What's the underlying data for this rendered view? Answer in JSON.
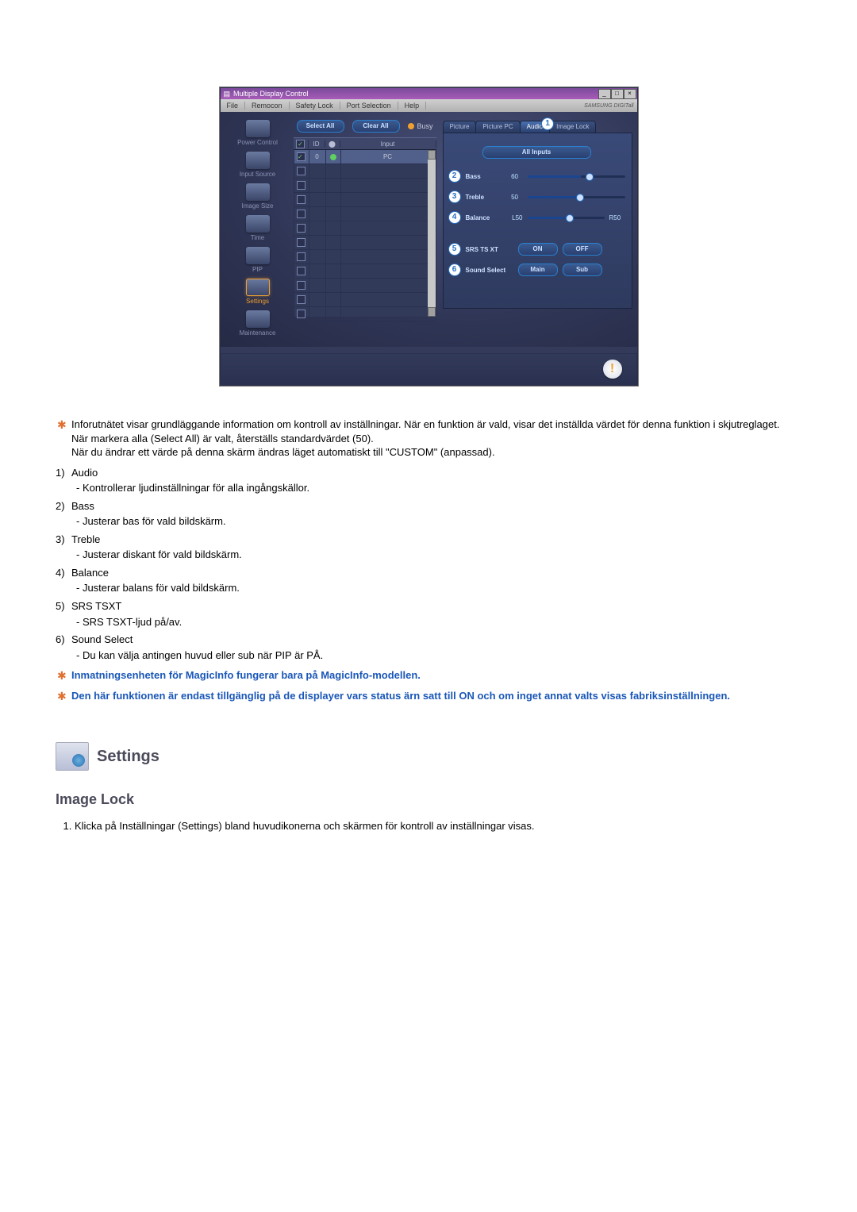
{
  "app": {
    "title": "Multiple Display Control",
    "window_buttons": {
      "min": "_",
      "max": "□",
      "close": "×"
    },
    "menubar": [
      "File",
      "Remocon",
      "Safety Lock",
      "Port Selection",
      "Help"
    ],
    "brand": "SAMSUNG DIGITall"
  },
  "sidebar": {
    "items": [
      {
        "label": "Power Control",
        "selected": false
      },
      {
        "label": "Input Source",
        "selected": false
      },
      {
        "label": "Image Size",
        "selected": false
      },
      {
        "label": "Time",
        "selected": false
      },
      {
        "label": "PIP",
        "selected": false
      },
      {
        "label": "Settings",
        "selected": true
      },
      {
        "label": "Maintenance",
        "selected": false
      }
    ]
  },
  "list_toolbar": {
    "select_all": "Select All",
    "clear_all": "Clear All",
    "busy": "Busy"
  },
  "grid": {
    "headers": {
      "chk": "",
      "id": "ID",
      "status": "",
      "input": "Input"
    },
    "rows": [
      {
        "checked": true,
        "id": "0",
        "status": "on",
        "input": "PC"
      },
      {
        "checked": false,
        "id": "",
        "status": "",
        "input": ""
      },
      {
        "checked": false,
        "id": "",
        "status": "",
        "input": ""
      },
      {
        "checked": false,
        "id": "",
        "status": "",
        "input": ""
      },
      {
        "checked": false,
        "id": "",
        "status": "",
        "input": ""
      },
      {
        "checked": false,
        "id": "",
        "status": "",
        "input": ""
      },
      {
        "checked": false,
        "id": "",
        "status": "",
        "input": ""
      },
      {
        "checked": false,
        "id": "",
        "status": "",
        "input": ""
      },
      {
        "checked": false,
        "id": "",
        "status": "",
        "input": ""
      },
      {
        "checked": false,
        "id": "",
        "status": "",
        "input": ""
      },
      {
        "checked": false,
        "id": "",
        "status": "",
        "input": ""
      },
      {
        "checked": false,
        "id": "",
        "status": "",
        "input": ""
      }
    ]
  },
  "tabs": [
    {
      "label": "Picture",
      "active": false
    },
    {
      "label": "Picture PC",
      "active": false
    },
    {
      "label": "Audio",
      "active": true,
      "callout": "1"
    },
    {
      "label": "Image Lock",
      "active": false
    }
  ],
  "panel": {
    "all_inputs": "All Inputs",
    "sliders": [
      {
        "n": "2",
        "label": "Bass",
        "value": "60",
        "pos": 60
      },
      {
        "n": "3",
        "label": "Treble",
        "value": "50",
        "pos": 50
      },
      {
        "n": "4",
        "label": "Balance",
        "left": "L50",
        "right": "R50",
        "pos": 50
      }
    ],
    "options": [
      {
        "n": "5",
        "label": "SRS TS XT",
        "a": "ON",
        "b": "OFF"
      },
      {
        "n": "6",
        "label": "Sound Select",
        "a": "Main",
        "b": "Sub"
      }
    ]
  },
  "bottom": {
    "alert": "!"
  },
  "doc": {
    "intro": [
      "Inforutnätet visar grundläggande information om kontroll av inställningar. När en funktion är vald, visar det inställda värdet för denna funktion i skjutreglaget.",
      "När markera alla (Select All) är valt, återställs standardvärdet (50).",
      "När du ändrar ett värde på denna skärm ändras läget automatiskt till \"CUSTOM\" (anpassad)."
    ],
    "items": [
      {
        "n": "1)",
        "title": "Audio",
        "desc": "- Kontrollerar ljudinställningar för alla ingångskällor."
      },
      {
        "n": "2)",
        "title": "Bass",
        "desc": "- Justerar bas för vald bildskärm."
      },
      {
        "n": "3)",
        "title": "Treble",
        "desc": "- Justerar diskant för vald bildskärm."
      },
      {
        "n": "4)",
        "title": "Balance",
        "desc": "- Justerar balans för vald bildskärm."
      },
      {
        "n": "5)",
        "title": "SRS TSXT",
        "desc": "- SRS TSXT-ljud på/av."
      },
      {
        "n": "6)",
        "title": "Sound Select",
        "desc": "- Du kan välja antingen huvud eller sub när PIP är PÅ."
      }
    ],
    "blue_notes": [
      "Inmatningsenheten för MagicInfo fungerar bara på MagicInfo-modellen.",
      "Den här funktionen är endast tillgänglig på de displayer vars status ärn satt till ON och om inget annat valts visas fabriksinställningen."
    ],
    "section_title": "Settings",
    "subhead": "Image Lock",
    "steps": [
      "Klicka på Inställningar (Settings) bland huvudikonerna och skärmen för kontroll av inställningar visas."
    ]
  }
}
